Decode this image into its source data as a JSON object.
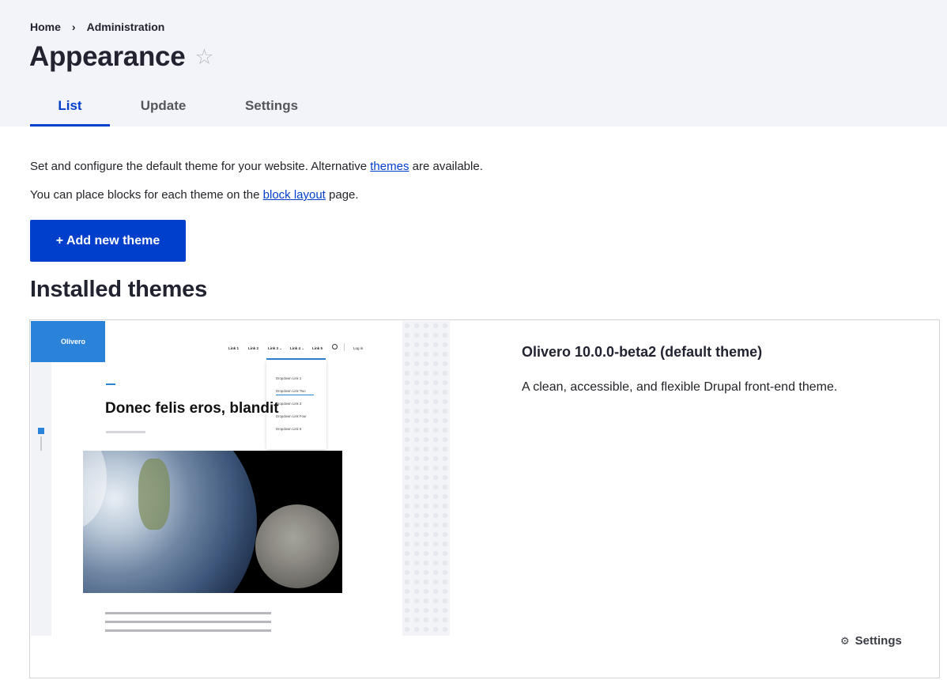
{
  "breadcrumb": {
    "items": [
      "Home",
      "Administration"
    ],
    "separator": "›"
  },
  "page": {
    "title": "Appearance",
    "star_icon": "star-outline-icon"
  },
  "tabs": [
    {
      "label": "List",
      "active": true
    },
    {
      "label": "Update",
      "active": false
    },
    {
      "label": "Settings",
      "active": false
    }
  ],
  "intro": {
    "line1_before": "Set and configure the default theme for your website. Alternative ",
    "line1_link": "themes",
    "line1_after": " are available.",
    "line2_before": "You can place blocks for each theme on the ",
    "line2_link": "block layout",
    "line2_after": " page."
  },
  "add_button": {
    "label": "+ Add new theme"
  },
  "installed": {
    "title": "Installed themes"
  },
  "theme": {
    "name": "Olivero 10.0.0-beta2 (default theme)",
    "description": "A clean, accessible, and flexible Drupal front-end theme.",
    "settings_label": "Settings",
    "settings_icon": "gear-icon"
  },
  "preview": {
    "logo": "Olivero",
    "nav": [
      "Link 1",
      "Link 2",
      "Link 3 ⌄",
      "Link 4 ⌄",
      "Link 5"
    ],
    "login": "Log in",
    "dropdown": [
      "Dropdown Link 1",
      "Dropdown Link Two",
      "Dropdown Link 3",
      "Dropdown Link Four",
      "Dropdown Link 5"
    ],
    "heading": "Donec felis eros, blandit"
  },
  "colors": {
    "accent": "#003ecc",
    "header_bg": "#f3f4f9",
    "preview_blue": "#2b82d9"
  }
}
